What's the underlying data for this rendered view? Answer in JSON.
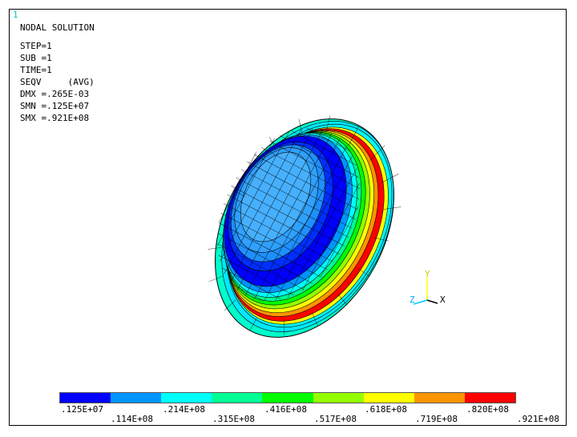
{
  "window_number": "1",
  "info": {
    "title": "NODAL SOLUTION",
    "step": "STEP=1",
    "sub": "SUB =1",
    "time": "TIME=1",
    "result": "SEQV     (AVG)",
    "dmx": "DMX =.265E-03",
    "smn": "SMN =.125E+07",
    "smx": "SMX =.921E+08"
  },
  "legend": {
    "colors": [
      "#0000ff",
      "#0094ff",
      "#00ffff",
      "#00ff94",
      "#00ff00",
      "#94ff00",
      "#ffff00",
      "#ff9400",
      "#ff0000"
    ],
    "labels_top": [
      ".125E+07",
      ".214E+08",
      ".416E+08",
      ".618E+08",
      ".820E+08"
    ],
    "labels_bottom": [
      ".114E+08",
      ".315E+08",
      ".517E+08",
      ".719E+08",
      ".921E+08"
    ]
  },
  "triad": {
    "y": "Y",
    "z": "Z",
    "x": "X"
  }
}
